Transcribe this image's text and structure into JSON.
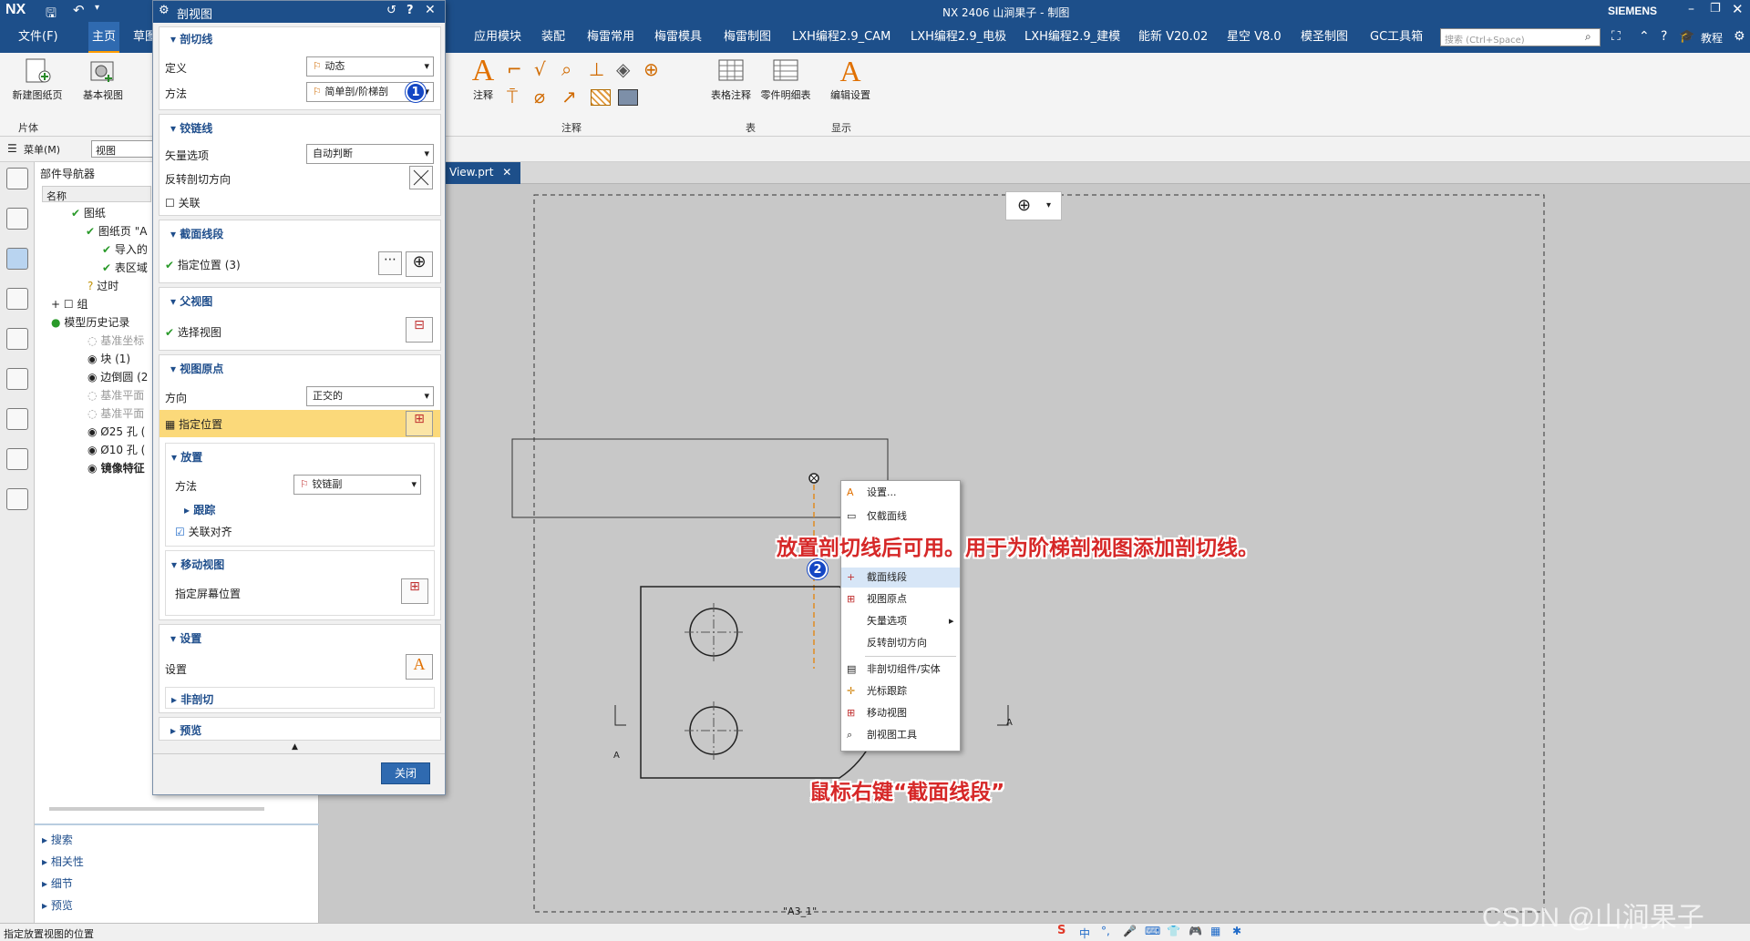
{
  "titlebar": {
    "logo": "NX",
    "title": "NX 2406 山涧果子 - 制图",
    "brand": "SIEMENS"
  },
  "menubar": {
    "items": [
      "文件(F)",
      "主页",
      "草图",
      "应用模块",
      "装配",
      "梅雷常用",
      "梅雷模具",
      "梅雷制图",
      "LXH编程2.9_CAM",
      "LXH编程2.9_电极",
      "LXH编程2.9_建模",
      "能新 V20.02",
      "星空 V8.0",
      "模圣制图",
      "GC工具箱"
    ],
    "search_placeholder": "搜索 (Ctrl+Space)",
    "tutorial": "教程"
  },
  "ribbon": {
    "new_sheet": "新建图纸页",
    "base_view": "基本视图",
    "group_sheet": "片体",
    "note": "注释",
    "group_annotation": "注释",
    "table_note": "表格注释",
    "parts_list": "零件明细表",
    "group_table": "表",
    "edit_settings": "编辑设置",
    "group_display": "显示"
  },
  "selbar": {
    "menu": "菜单(M)",
    "filter": "视图"
  },
  "navigator": {
    "title": "部件导航器",
    "col_name": "名称",
    "items": [
      "图纸",
      "图纸页 \"A",
      "导入的",
      "表区域",
      "过时",
      "组",
      "模型历史记录",
      "基准坐标",
      "块 (1)",
      "边倒圆 (2",
      "基准平面",
      "基准平面",
      "Ø25 孔 (",
      "Ø10 孔 (",
      "镜像特征"
    ],
    "bottom": [
      "搜索",
      "相关性",
      "细节",
      "预览"
    ]
  },
  "dialog": {
    "title": "剖视图",
    "sec_cutline": "剖切线",
    "def_label": "定义",
    "def_value": "动态",
    "method_label": "方法",
    "method_value": "简单剖/阶梯剖",
    "sec_hinge": "铰链线",
    "vector_label": "矢量选项",
    "vector_value": "自动判断",
    "reverse_label": "反转剖切方向",
    "assoc_label": "关联",
    "sec_segment": "截面线段",
    "segment_pos": "指定位置 (3)",
    "sec_parent": "父视图",
    "select_view": "选择视图",
    "sec_origin": "视图原点",
    "dir_label": "方向",
    "dir_value": "正交的",
    "origin_pos": "指定位置",
    "sub_place": "放置",
    "place_method": "方法",
    "place_value": "铰链副",
    "track": "跟踪",
    "assoc_align": "关联对齐",
    "sub_move": "移动视图",
    "screen_pos": "指定屏幕位置",
    "sec_settings": "设置",
    "settings_label": "设置",
    "non_section": "非剖切",
    "preview": "预览",
    "close": "关闭"
  },
  "file_tab": "View.prt",
  "context_menu": [
    "设置...",
    "仅截面线",
    "截面线段",
    "视图原点",
    "矢量选项",
    "反转剖切方向",
    "非剖切组件/实体",
    "光标跟踪",
    "移动视图",
    "剖视图工具"
  ],
  "drawing": {
    "section_label_left": "A",
    "section_label_right": "A",
    "sheet": "\"A3_1\""
  },
  "callouts": {
    "top": "放置剖切线后可用。用于为阶梯剖视图添加剖切线。",
    "bottom": "鼠标右键“截面线段”"
  },
  "badges": [
    "1",
    "2"
  ],
  "statusbar": {
    "message": "指定放置视图的位置"
  },
  "watermark": "CSDN @山涧果子",
  "ime": "中"
}
